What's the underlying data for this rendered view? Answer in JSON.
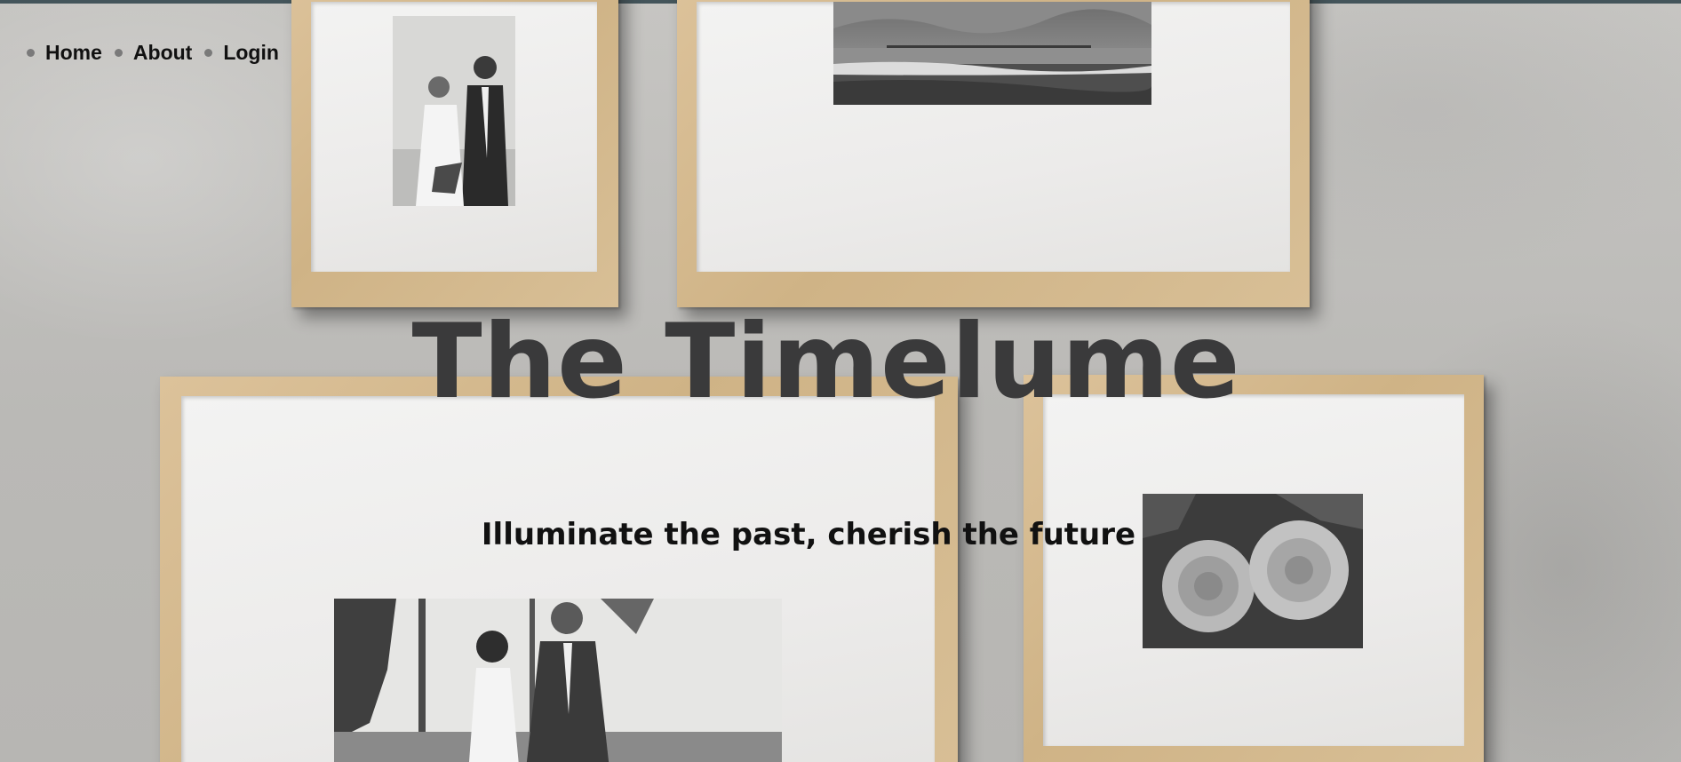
{
  "nav": {
    "items": [
      {
        "label": "Home"
      },
      {
        "label": "About"
      },
      {
        "label": "Login"
      }
    ]
  },
  "hero": {
    "title": "The Timelume",
    "subtitle": "Illuminate the past, cherish the future"
  },
  "gallery": {
    "photos": [
      {
        "icon": "couple-portrait-photo"
      },
      {
        "icon": "beach-pier-photo"
      },
      {
        "icon": "couple-walking-photo"
      },
      {
        "icon": "roses-photo"
      }
    ]
  },
  "colors": {
    "top_strip": "#44555b",
    "frame_wood": "#d6bc92",
    "title_text": "#3a3a3b",
    "nav_text": "#111111"
  }
}
